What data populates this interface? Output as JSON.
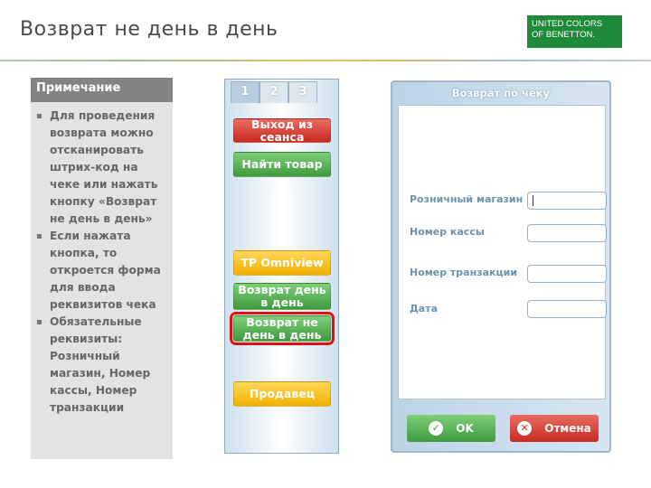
{
  "header": {
    "title": "Возврат не день в день",
    "logo_lines": [
      "UNITED COLORS",
      "OF BENETTON."
    ]
  },
  "note": {
    "title": "Примечание",
    "items": [
      "Для проведения возврата можно отсканировать штрих-код на чеке или нажать кнопку «Возврат не день в день»",
      "Если нажата кнопка, то откроется форма для ввода реквизитов чека",
      "Обязательные реквизиты: Розничный магазин, Номер кассы, Номер транзакции"
    ]
  },
  "pos_panel": {
    "tabs": [
      "1",
      "2",
      "3"
    ],
    "active_tab": "1",
    "buttons": {
      "logout": "Выход из сеанса",
      "find_product": "Найти товар",
      "tp_omniview": "TP Omniview",
      "return_day": "Возврат день в день",
      "return_not_day": "Возврат не день в день",
      "seller": "Продавец"
    }
  },
  "receipt_form": {
    "title": "Возврат по чеку",
    "fields": {
      "store": "Розничный магазин",
      "register": "Номер кассы",
      "transaction": "Номер транзакции",
      "date": "Дата"
    },
    "ok_label": "OK",
    "cancel_label": "Отмена"
  },
  "colors": {
    "logo": "#1f8a3a",
    "button_red": "#c82b22",
    "button_green": "#3f9a3f",
    "button_yellow": "#f0b000",
    "highlight": "#e01010",
    "note_header": "#838383"
  }
}
